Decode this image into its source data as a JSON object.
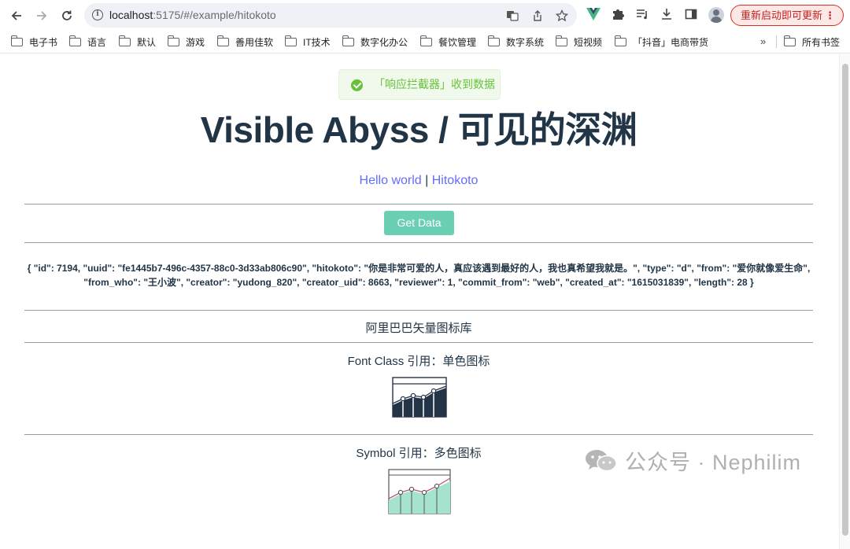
{
  "browser": {
    "url_host": "localhost",
    "url_path": ":5175/#/example/hitokoto",
    "update_button": "重新启动即可更新",
    "bookmarks": [
      "电子书",
      "语言",
      "默认",
      "游戏",
      "善用佳软",
      "IT技术",
      "数字化办公",
      "餐饮管理",
      "数字系统",
      "短视频",
      "「抖音」电商带货"
    ],
    "bookmarks_more": "»",
    "all_bookmarks": "所有书签"
  },
  "page": {
    "toast": "「响应拦截器」收到数据",
    "title": "Visible Abyss / 可见的深渊",
    "link_hello": "Hello world",
    "link_sep": " | ",
    "link_hitokoto": "Hitokoto",
    "get_data_button": "Get Data",
    "json_output": "{ \"id\": 7194, \"uuid\": \"fe1445b7-496c-4357-88c0-3d33ab806c90\", \"hitokoto\": \"你是非常可爱的人，真应该遇到最好的人，我也真希望我就是。\", \"type\": \"d\", \"from\": \"爱你就像爱生命\", \"from_who\": \"王小波\", \"creator\": \"yudong_820\", \"creator_uid\": 8663, \"reviewer\": 1, \"commit_from\": \"web\", \"created_at\": \"1615031839\", \"length\": 28 }",
    "iconfont_title": "阿里巴巴矢量图标库",
    "font_class_title": "Font Class 引用：单色图标",
    "symbol_title": "Symbol 引用：多色图标"
  },
  "watermark": "公众号 · Nephilim",
  "colors": {
    "accent_link": "#646cff",
    "button": "#6bcfb3",
    "toast_text": "#67c23a",
    "heading": "#213547",
    "update_red": "#c5221f"
  }
}
